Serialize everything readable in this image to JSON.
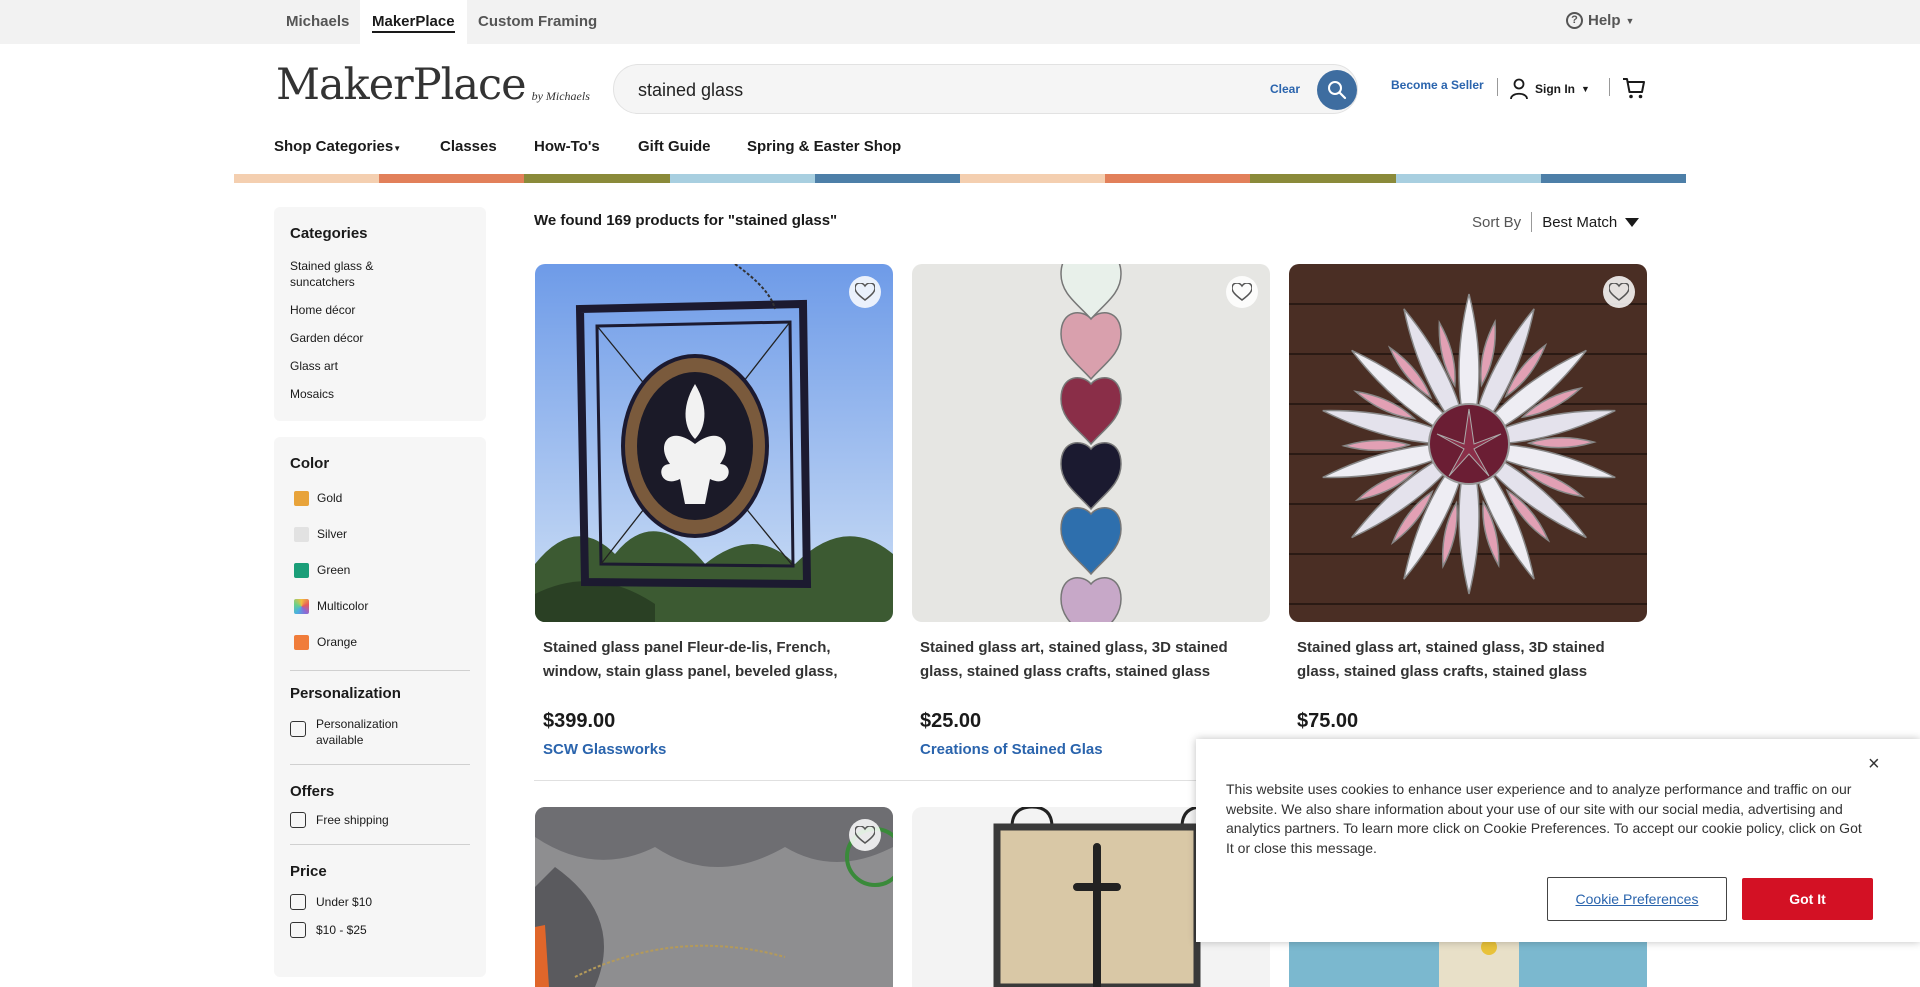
{
  "topbar": {
    "tabs": [
      {
        "label": "Michaels"
      },
      {
        "label": "MakerPlace"
      },
      {
        "label": "Custom Framing"
      }
    ],
    "help_label": "Help"
  },
  "header": {
    "logo_text": "MakerPlace",
    "logo_by": "by Michaels",
    "search_value": "stained glass",
    "clear_label": "Clear",
    "become_seller": "Become a Seller",
    "sign_in": "Sign In"
  },
  "nav": {
    "items": [
      {
        "label": "Shop Categories"
      },
      {
        "label": "Classes"
      },
      {
        "label": "How-To's"
      },
      {
        "label": "Gift Guide"
      },
      {
        "label": "Spring & Easter Shop"
      }
    ]
  },
  "stripe_colors": [
    "#f4cfb0",
    "#e2805a",
    "#8a8a3a",
    "#a8cfe0",
    "#4d7fa8",
    "#f4cfb0",
    "#e2805a",
    "#8a8a3a",
    "#a8cfe0",
    "#4d7fa8"
  ],
  "sidebar": {
    "categories": {
      "heading": "Categories",
      "items": [
        {
          "label": "Stained glass & suncatchers"
        },
        {
          "label": "Home décor"
        },
        {
          "label": "Garden décor"
        },
        {
          "label": "Glass art"
        },
        {
          "label": "Mosaics"
        }
      ]
    },
    "color": {
      "heading": "Color",
      "items": [
        {
          "label": "Gold",
          "color": "#e8a33a"
        },
        {
          "label": "Silver",
          "color": "#e2e2e2"
        },
        {
          "label": "Green",
          "color": "#1a9e78"
        },
        {
          "label": "Multicolor",
          "color": "multicolor"
        },
        {
          "label": "Orange",
          "color": "#f07c3a"
        }
      ]
    },
    "personalization": {
      "heading": "Personalization",
      "option": "Personalization available"
    },
    "offers": {
      "heading": "Offers",
      "option": "Free shipping"
    },
    "price": {
      "heading": "Price",
      "options": [
        {
          "label": "Under $10"
        },
        {
          "label": "$10 - $25"
        }
      ]
    }
  },
  "results": {
    "summary": "We found 169 products for \"stained glass\"",
    "sort_label": "Sort By",
    "sort_value": "Best Match"
  },
  "products": [
    {
      "title": "Stained glass panel Fleur-de-lis, French, window, stain glass panel, beveled glass, vintage,...",
      "price": "$399.00",
      "shop": "SCW Glassworks"
    },
    {
      "title": "Stained glass art, stained glass, 3D stained glass, stained glass crafts, stained glass designs,...",
      "price": "$25.00",
      "shop": "Creations of Stained Glas"
    },
    {
      "title": "Stained glass art, stained glass, 3D stained glass, stained glass crafts, stained glass designs,...",
      "price": "$75.00",
      "shop": ""
    }
  ],
  "cookie": {
    "message": "This website uses cookies to enhance user experience and to analyze performance and traffic on our website. We also share information about your use of our site with our social media, advertising and analytics partners. To learn more click on Cookie Preferences. To accept our cookie policy, click on Got It or close this message.",
    "prefs_label": "Cookie Preferences",
    "got_it_label": "Got It",
    "close_label": "×"
  }
}
